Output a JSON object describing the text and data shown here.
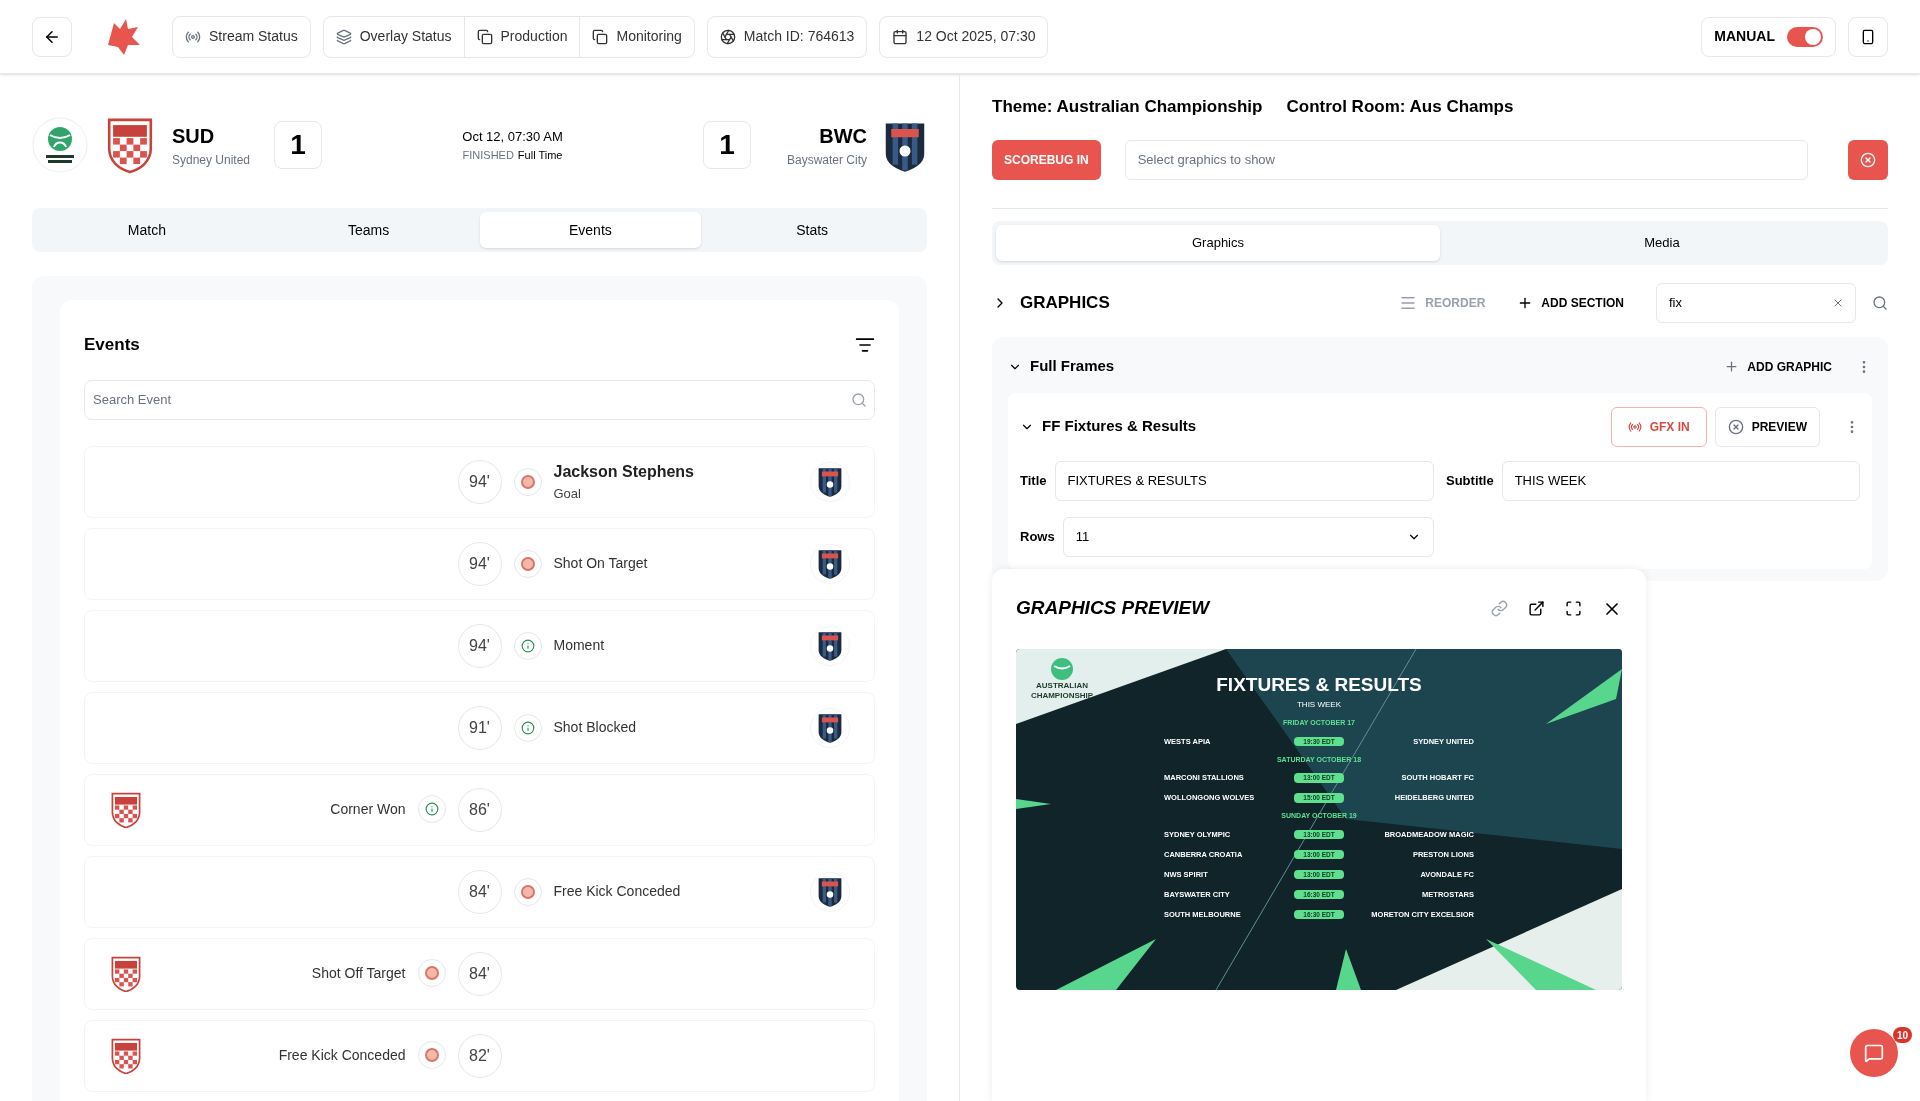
{
  "topbar": {
    "stream_status": "Stream Status",
    "overlay_status": "Overlay Status",
    "production": "Production",
    "monitoring": "Monitoring",
    "match_id": "Match ID: 764613",
    "date": "12 Oct 2025, 07:30",
    "mode": {
      "label": "MANUAL",
      "on": true
    }
  },
  "match": {
    "home": {
      "code": "SUD",
      "name": "Sydney United",
      "score": "1"
    },
    "away": {
      "code": "BWC",
      "name": "Bayswater City",
      "score": "1"
    },
    "datetime": "Oct 12, 07:30 AM",
    "status": "FINISHED",
    "period": "Full Time"
  },
  "tabs": [
    {
      "label": "Match",
      "selected": false
    },
    {
      "label": "Teams",
      "selected": false
    },
    {
      "label": "Events",
      "selected": true
    },
    {
      "label": "Stats",
      "selected": false
    }
  ],
  "events": {
    "title": "Events",
    "search": {
      "placeholder": "Search Event"
    },
    "items": [
      {
        "home": false,
        "minute": "94'",
        "kind": "ball",
        "title": "Jackson Stephens",
        "subtitle": "Goal"
      },
      {
        "home": false,
        "minute": "94'",
        "kind": "ball",
        "title": "Shot On Target"
      },
      {
        "home": false,
        "minute": "94'",
        "kind": "info",
        "title": "Moment"
      },
      {
        "home": false,
        "minute": "91'",
        "kind": "info",
        "title": "Shot Blocked"
      },
      {
        "home": true,
        "minute": "86'",
        "kind": "info",
        "title": "Corner Won"
      },
      {
        "home": false,
        "minute": "84'",
        "kind": "ball",
        "title": "Free Kick Conceded"
      },
      {
        "home": true,
        "minute": "84'",
        "kind": "ball",
        "title": "Shot Off Target"
      },
      {
        "home": true,
        "minute": "82'",
        "kind": "ball",
        "title": "Free Kick Conceded"
      }
    ]
  },
  "control": {
    "theme": "Theme: Australian Championship",
    "control_room": "Control Room: Aus Champs",
    "scorebug": "SCOREBUG IN",
    "graphics_select": {
      "placeholder": "Select graphics to show"
    },
    "tabs": [
      {
        "label": "Graphics",
        "selected": true
      },
      {
        "label": "Media",
        "selected": false
      }
    ],
    "graphics": {
      "title": "GRAPHICS",
      "expanded": false,
      "reorder": "REORDER",
      "add_section": "ADD SECTION",
      "search": "fix",
      "section": {
        "title": "Full Frames",
        "expanded": true,
        "add_graphic": "ADD GRAPHIC",
        "item": {
          "title": "FF Fixtures & Results",
          "expanded": true,
          "gfx_in": "GFX IN",
          "preview": "PREVIEW",
          "fields": [
            {
              "label": "Title",
              "value": "FIXTURES & RESULTS"
            },
            {
              "label": "Subtitle",
              "value": "THIS WEEK"
            },
            {
              "label": "Rows",
              "value": "11",
              "kind": "select"
            }
          ]
        }
      }
    }
  },
  "preview": {
    "title": "GRAPHICS PREVIEW",
    "graphic": {
      "logo": "AUSTRALIAN CHAMPIONSHIP",
      "heading": "FIXTURES & RESULTS",
      "subheading": "THIS WEEK",
      "days": [
        {
          "day": "FRIDAY OCTOBER 17",
          "matches": [
            [
              "WESTS APIA",
              "19:30 EDT",
              "SYDNEY UNITED"
            ]
          ]
        },
        {
          "day": "SATURDAY OCTOBER 18",
          "matches": [
            [
              "MARCONI STALLIONS",
              "13:00 EDT",
              "SOUTH HOBART FC"
            ],
            [
              "WOLLONGONG WOLVES",
              "15:00 EDT",
              "HEIDELBERG UNITED"
            ]
          ]
        },
        {
          "day": "SUNDAY OCTOBER 19",
          "matches": [
            [
              "SYDNEY OLYMPIC",
              "13:00 EDT",
              "BROADMEADOW MAGIC"
            ],
            [
              "CANBERRA CROATIA",
              "13:00 EDT",
              "PRESTON LIONS"
            ],
            [
              "NWS SPIRIT",
              "13:00 EDT",
              "AVONDALE FC"
            ],
            [
              "BAYSWATER CITY",
              "16:30 EDT",
              "METROSTARS"
            ],
            [
              "SOUTH MELBOURNE",
              "16:30 EDT",
              "MORETON CITY EXCELSIOR"
            ]
          ]
        }
      ]
    }
  },
  "chat": {
    "badge": "10"
  }
}
